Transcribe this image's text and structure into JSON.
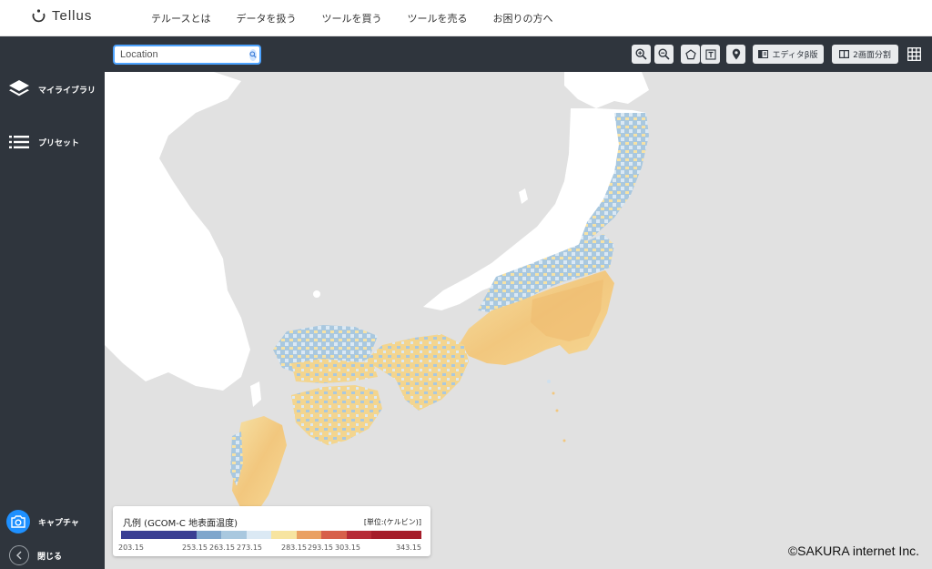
{
  "header": {
    "logo_text": "Tellus",
    "nav": [
      "テルースとは",
      "データを扱う",
      "ツールを買う",
      "ツールを売る",
      "お困りの方へ"
    ]
  },
  "sidebar": {
    "items": [
      {
        "label": "マイライブラリ",
        "icon": "layers-icon"
      },
      {
        "label": "プリセット",
        "icon": "list-icon"
      }
    ],
    "capture_label": "キャプチャ",
    "close_label": "閉じる"
  },
  "toolbar": {
    "search_placeholder": "Location",
    "editor_label": "エディタβ版",
    "split_label": "2画面分割"
  },
  "legend": {
    "title": "凡例 (GCOM-C 地表面温度)",
    "unit": "[単位:(ケルビン)]",
    "colors": [
      "#3a3f93",
      "#3a3f93",
      "#3a3f93",
      "#7fa6cc",
      "#a9c8df",
      "#dbe9f4",
      "#f7e4a0",
      "#eaa062",
      "#d7604a",
      "#b62b36",
      "#a51d2a",
      "#a51d2a"
    ],
    "ticks": [
      "203.15",
      "253.15",
      "263.15",
      "273.15",
      "283.15",
      "293.15",
      "303.15",
      "343.15"
    ]
  },
  "copyright": "©SAKURA internet Inc.",
  "colors": {
    "sidebar_bg": "#2f353d",
    "accent": "#1e90ff",
    "map_bg": "#e1e1e1"
  }
}
